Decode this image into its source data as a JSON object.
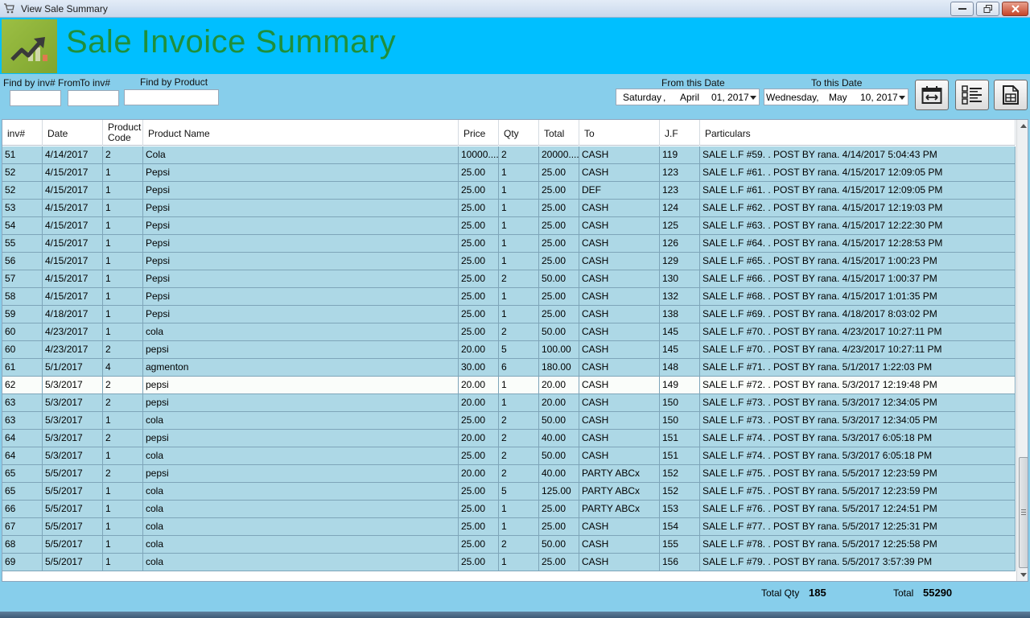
{
  "window": {
    "title": "View Sale Summary"
  },
  "header": {
    "title": "Sale Invoice Summary"
  },
  "filters": {
    "inv_from_label": "Find by inv# From",
    "inv_to_label": "To inv#",
    "product_label": "Find by Product",
    "inv_from_value": "",
    "inv_to_value": "",
    "product_value": "",
    "from_date_label": "From this Date",
    "to_date_label": "To this Date",
    "from_date": {
      "weekday": "Saturday",
      "sep": ",",
      "month": "April",
      "day_year": "01, 2017"
    },
    "to_date": {
      "weekday": "Wednesday,",
      "month": "May",
      "day_year": "10, 2017"
    }
  },
  "grid": {
    "columns": [
      "inv#",
      "Date",
      "Product Code",
      "Product Name",
      "Price",
      "Qty",
      "Total",
      "To",
      "J.F",
      "Particulars"
    ],
    "rows": [
      [
        "51",
        "4/14/2017",
        "2",
        "Cola",
        "10000....",
        "2",
        "20000....",
        "CASH",
        "119",
        "SALE L.F #59. . POST BY rana. 4/14/2017 5:04:43 PM"
      ],
      [
        "52",
        "4/15/2017",
        "1",
        "Pepsi",
        "25.00",
        "1",
        "25.00",
        "CASH",
        "123",
        "SALE L.F #61. . POST BY rana. 4/15/2017 12:09:05 PM"
      ],
      [
        "52",
        "4/15/2017",
        "1",
        "Pepsi",
        "25.00",
        "1",
        "25.00",
        "DEF",
        "123",
        "SALE L.F #61. . POST BY rana. 4/15/2017 12:09:05 PM"
      ],
      [
        "53",
        "4/15/2017",
        "1",
        "Pepsi",
        "25.00",
        "1",
        "25.00",
        "CASH",
        "124",
        "SALE L.F #62. . POST BY rana. 4/15/2017 12:19:03 PM"
      ],
      [
        "54",
        "4/15/2017",
        "1",
        "Pepsi",
        "25.00",
        "1",
        "25.00",
        "CASH",
        "125",
        "SALE L.F #63. . POST BY rana. 4/15/2017 12:22:30 PM"
      ],
      [
        "55",
        "4/15/2017",
        "1",
        "Pepsi",
        "25.00",
        "1",
        "25.00",
        "CASH",
        "126",
        "SALE L.F #64. . POST BY rana. 4/15/2017 12:28:53 PM"
      ],
      [
        "56",
        "4/15/2017",
        "1",
        "Pepsi",
        "25.00",
        "1",
        "25.00",
        "CASH",
        "129",
        "SALE L.F #65. . POST BY rana. 4/15/2017 1:00:23 PM"
      ],
      [
        "57",
        "4/15/2017",
        "1",
        "Pepsi",
        "25.00",
        "2",
        "50.00",
        "CASH",
        "130",
        "SALE L.F #66. . POST BY rana. 4/15/2017 1:00:37 PM"
      ],
      [
        "58",
        "4/15/2017",
        "1",
        "Pepsi",
        "25.00",
        "1",
        "25.00",
        "CASH",
        "132",
        "SALE L.F #68. . POST BY rana. 4/15/2017 1:01:35 PM"
      ],
      [
        "59",
        "4/18/2017",
        "1",
        "Pepsi",
        "25.00",
        "1",
        "25.00",
        "CASH",
        "138",
        "SALE L.F #69. . POST BY rana. 4/18/2017 8:03:02 PM"
      ],
      [
        "60",
        "4/23/2017",
        "1",
        "cola",
        "25.00",
        "2",
        "50.00",
        "CASH",
        "145",
        "SALE L.F #70. . POST BY rana. 4/23/2017 10:27:11 PM"
      ],
      [
        "60",
        "4/23/2017",
        "2",
        "pepsi",
        "20.00",
        "5",
        "100.00",
        "CASH",
        "145",
        "SALE L.F #70. . POST BY rana. 4/23/2017 10:27:11 PM"
      ],
      [
        "61",
        "5/1/2017",
        "4",
        "agmenton",
        "30.00",
        "6",
        "180.00",
        "CASH",
        "148",
        "SALE L.F #71. . POST BY rana. 5/1/2017 1:22:03 PM"
      ],
      [
        "62",
        "5/3/2017",
        "2",
        "pepsi",
        "20.00",
        "1",
        "20.00",
        "CASH",
        "149",
        "SALE L.F #72. . POST BY rana. 5/3/2017 12:19:48 PM"
      ],
      [
        "63",
        "5/3/2017",
        "2",
        "pepsi",
        "20.00",
        "1",
        "20.00",
        "CASH",
        "150",
        "SALE L.F #73. . POST BY rana. 5/3/2017 12:34:05 PM"
      ],
      [
        "63",
        "5/3/2017",
        "1",
        "cola",
        "25.00",
        "2",
        "50.00",
        "CASH",
        "150",
        "SALE L.F #73. . POST BY rana. 5/3/2017 12:34:05 PM"
      ],
      [
        "64",
        "5/3/2017",
        "2",
        "pepsi",
        "20.00",
        "2",
        "40.00",
        "CASH",
        "151",
        "SALE L.F #74. . POST BY rana. 5/3/2017 6:05:18 PM"
      ],
      [
        "64",
        "5/3/2017",
        "1",
        "cola",
        "25.00",
        "2",
        "50.00",
        "CASH",
        "151",
        "SALE L.F #74. . POST BY rana. 5/3/2017 6:05:18 PM"
      ],
      [
        "65",
        "5/5/2017",
        "2",
        "pepsi",
        "20.00",
        "2",
        "40.00",
        "PARTY ABCx",
        "152",
        "SALE L.F #75. . POST BY rana. 5/5/2017 12:23:59 PM"
      ],
      [
        "65",
        "5/5/2017",
        "1",
        "cola",
        "25.00",
        "5",
        "125.00",
        "PARTY ABCx",
        "152",
        "SALE L.F #75. . POST BY rana. 5/5/2017 12:23:59 PM"
      ],
      [
        "66",
        "5/5/2017",
        "1",
        "cola",
        "25.00",
        "1",
        "25.00",
        "PARTY ABCx",
        "153",
        "SALE L.F #76. . POST BY rana. 5/5/2017 12:24:51 PM"
      ],
      [
        "67",
        "5/5/2017",
        "1",
        "cola",
        "25.00",
        "1",
        "25.00",
        "CASH",
        "154",
        "SALE L.F #77. . POST BY rana. 5/5/2017 12:25:31 PM"
      ],
      [
        "68",
        "5/5/2017",
        "1",
        "cola",
        "25.00",
        "2",
        "50.00",
        "CASH",
        "155",
        "SALE L.F #78. . POST BY rana. 5/5/2017 12:25:58 PM"
      ],
      [
        "69",
        "5/5/2017",
        "1",
        "cola",
        "25.00",
        "1",
        "25.00",
        "CASH",
        "156",
        "SALE L.F #79. . POST BY rana. 5/5/2017 3:57:39 PM"
      ]
    ],
    "selected_row": 13
  },
  "footer": {
    "total_qty_label": "Total Qty",
    "total_qty": "185",
    "total_label": "Total",
    "total": "55290"
  },
  "colors": {
    "banner": "#00bfff",
    "title_text": "#1f8f3b",
    "row": "#add8e6",
    "background": "#87ceeb"
  },
  "icons": {
    "logo": "trending-up-chart-icon",
    "date_range_button": "calendar-range-icon",
    "list_button": "checklist-icon",
    "report_button": "document-report-icon"
  }
}
